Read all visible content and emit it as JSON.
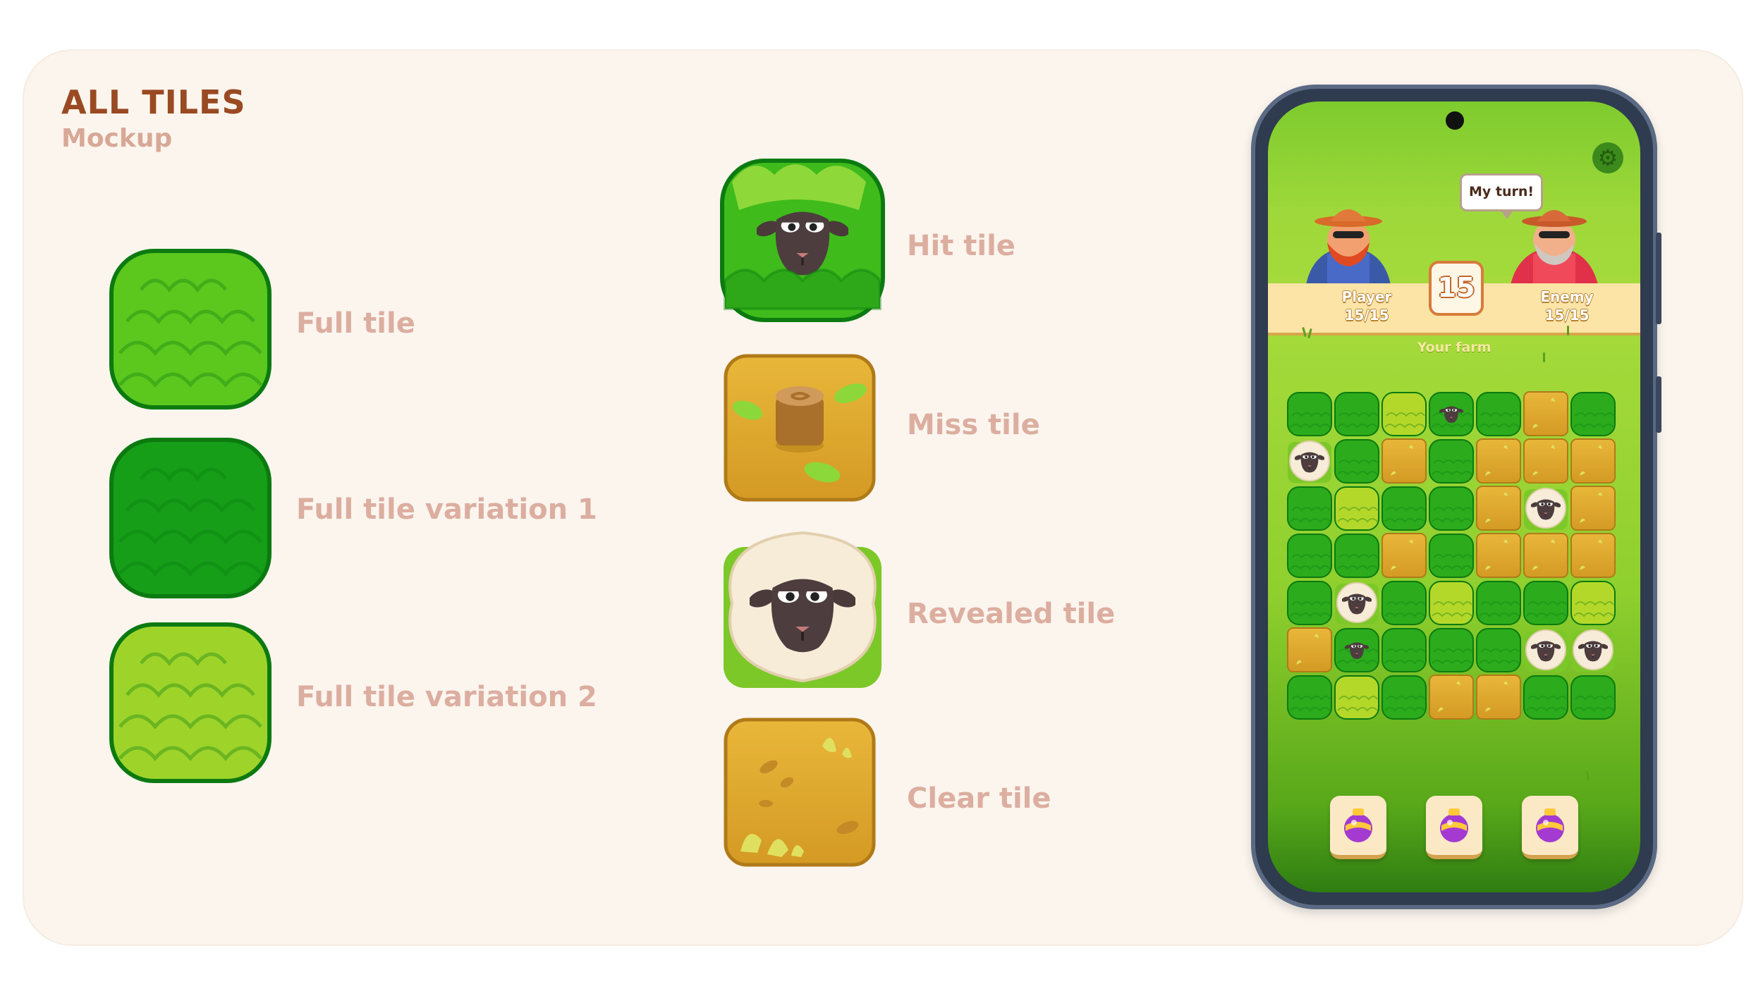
{
  "header": {
    "title": "ALL TILES",
    "subtitle": "Mockup"
  },
  "tiles_left": [
    {
      "label": "Full tile",
      "icon": "bush-tile-icon"
    },
    {
      "label": "Full tile variation 1",
      "icon": "bush-dark-tile-icon"
    },
    {
      "label": "Full tile variation 2",
      "icon": "bush-yellow-tile-icon"
    }
  ],
  "tiles_right": [
    {
      "label": "Hit tile",
      "icon": "sheep-in-bush-icon"
    },
    {
      "label": "Miss tile",
      "icon": "tree-stump-icon"
    },
    {
      "label": "Revealed tile",
      "icon": "sheep-icon"
    },
    {
      "label": "Clear tile",
      "icon": "dirt-tile-icon"
    }
  ],
  "phone": {
    "bubble": "My turn!",
    "player": {
      "name": "Player",
      "score": "15/15"
    },
    "enemy": {
      "name": "Enemy",
      "score": "15/15"
    },
    "turn_counter": "15",
    "farm_label": "Your farm",
    "settings_icon": "gear-icon",
    "grid": [
      [
        "B",
        "B",
        "Y",
        "H",
        "B",
        "D",
        "B"
      ],
      [
        "S",
        "B",
        "D",
        "B",
        "D",
        "D",
        "D"
      ],
      [
        "B",
        "Y",
        "B",
        "B",
        "D",
        "S",
        "D"
      ],
      [
        "B",
        "B",
        "D",
        "B",
        "D",
        "D",
        "D"
      ],
      [
        "B",
        "S",
        "B",
        "Y",
        "B",
        "B",
        "Y"
      ],
      [
        "D",
        "H",
        "B",
        "B",
        "B",
        "S",
        "S"
      ],
      [
        "B",
        "Y",
        "B",
        "D",
        "D",
        "B",
        "B"
      ]
    ],
    "powerups": [
      "potion-icon",
      "potion-icon",
      "potion-icon"
    ]
  },
  "colors": {
    "title": "#9a4a22",
    "subtitle": "#d8a896",
    "label": "#dcaea0",
    "background": "#fbf5ee"
  }
}
